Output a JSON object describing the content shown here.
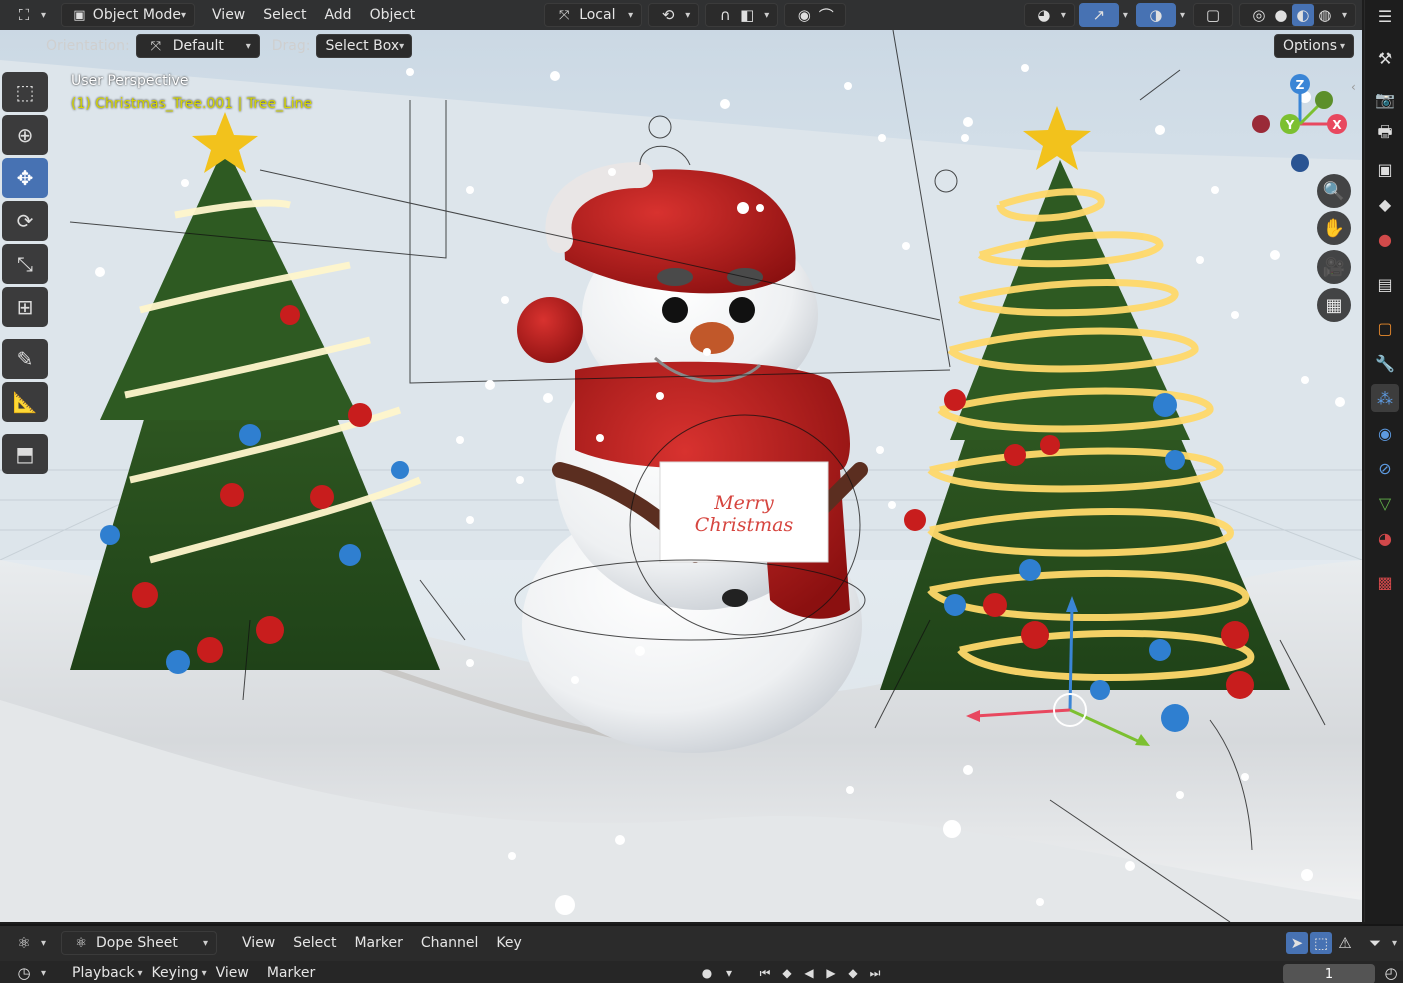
{
  "header": {
    "mode": "Object Mode",
    "menus": [
      "View",
      "Select",
      "Add",
      "Object"
    ],
    "transform_space": "Local",
    "options_label": "Options"
  },
  "toolsettings": {
    "orientation_label": "Orientation:",
    "orientation_value": "Default",
    "drag_label": "Drag:",
    "drag_value": "Select Box"
  },
  "viewport": {
    "title": "User Perspective",
    "active_object": "(1) Christmas_Tree.001 | Tree_Line",
    "card_text": "Merry Christmas"
  },
  "gizmo": {
    "x": "X",
    "y": "Y",
    "z": "Z"
  },
  "toolbar": {
    "tools": [
      "select-box-tool",
      "cursor-tool",
      "move-tool",
      "rotate-tool",
      "scale-tool",
      "transform-tool",
      "annotate-tool",
      "measure-tool",
      "add-cube-tool"
    ],
    "active": "move-tool"
  },
  "dopesheet": {
    "editor": "Dope Sheet",
    "menus": [
      "View",
      "Select",
      "Marker",
      "Channel",
      "Key"
    ]
  },
  "timeline": {
    "menus": [
      "Playback",
      "Keying",
      "View",
      "Marker"
    ],
    "current_frame": "1"
  },
  "colors": {
    "accent": "#4772b3",
    "header_bg": "#232323",
    "axis_x": "#e8485f",
    "axis_y": "#7cc030",
    "axis_z": "#3a85d6",
    "selection_text": "#d6d600"
  }
}
